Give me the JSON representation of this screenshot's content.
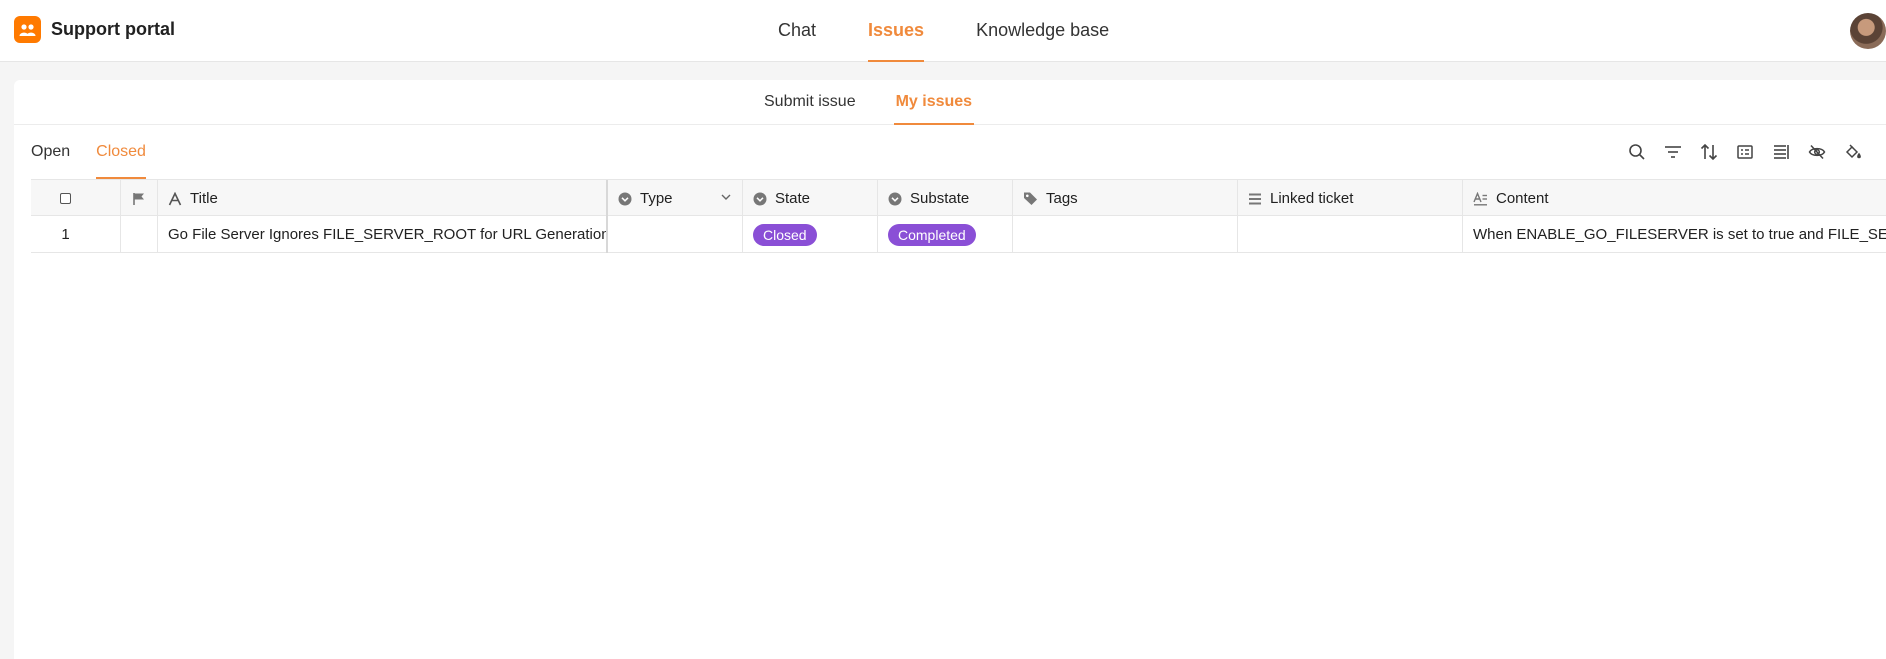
{
  "app": {
    "title": "Support portal",
    "logo_icon": "people-icon",
    "accent_color": "#f08a3c",
    "brand_color": "#ff7a00"
  },
  "main_nav": [
    {
      "label": "Chat",
      "active": false
    },
    {
      "label": "Issues",
      "active": true
    },
    {
      "label": "Knowledge base",
      "active": false
    }
  ],
  "sub_nav": [
    {
      "label": "Submit issue",
      "active": false
    },
    {
      "label": "My issues",
      "active": true
    }
  ],
  "view_tabs": [
    {
      "label": "Open",
      "active": false
    },
    {
      "label": "Closed",
      "active": true
    }
  ],
  "toolbar_icons": [
    "search-icon",
    "filter-icon",
    "sort-icon",
    "group-icon",
    "row-height-icon",
    "hide-columns-icon",
    "color-fill-icon"
  ],
  "table": {
    "columns": [
      {
        "label": "Title",
        "icon": "text-type-icon"
      },
      {
        "label": "Type",
        "icon": "single-select-icon"
      },
      {
        "label": "State",
        "icon": "single-select-icon"
      },
      {
        "label": "Substate",
        "icon": "single-select-icon"
      },
      {
        "label": "Tags",
        "icon": "tag-icon"
      },
      {
        "label": "Linked ticket",
        "icon": "link-list-icon"
      },
      {
        "label": "Content",
        "icon": "long-text-icon"
      }
    ],
    "rows": [
      {
        "index": "1",
        "title": "Go File Server Ignores FILE_SERVER_ROOT for URL Generation",
        "type": "",
        "state": "Closed",
        "substate": "Completed",
        "tags": "",
        "linked_ticket": "",
        "content": "When ENABLE_GO_FILESERVER is set to true and FILE_SERVER_ROOT"
      }
    ],
    "badge_color": "#8a4fd6"
  }
}
